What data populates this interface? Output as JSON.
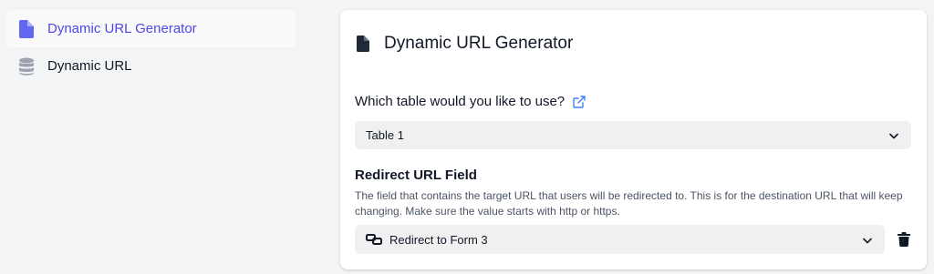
{
  "sidebar": {
    "items": [
      {
        "label": "Dynamic URL Generator",
        "icon": "document-icon",
        "active": true
      },
      {
        "label": "Dynamic URL",
        "icon": "database-icon",
        "active": false
      }
    ]
  },
  "card": {
    "title": "Dynamic URL Generator",
    "title_icon": "document-icon",
    "question": "Which table would you like to use?",
    "question_icon": "external-link-icon",
    "table_select": {
      "value": "Table 1",
      "icon": "chevron-down-icon"
    },
    "redirect_field": {
      "label": "Redirect URL Field",
      "help": "The field that contains the target URL that users will be redirected to. This is for the destination URL that will keep changing. Make sure the value starts with http or https.",
      "value": "Redirect to Form 3",
      "value_icon": "link-icon",
      "delete_icon": "trash-icon"
    }
  },
  "colors": {
    "accent": "#4f46e5",
    "accent_icon": "#6366f1",
    "background": "#f3f4f6",
    "link": "#3b82f6"
  }
}
